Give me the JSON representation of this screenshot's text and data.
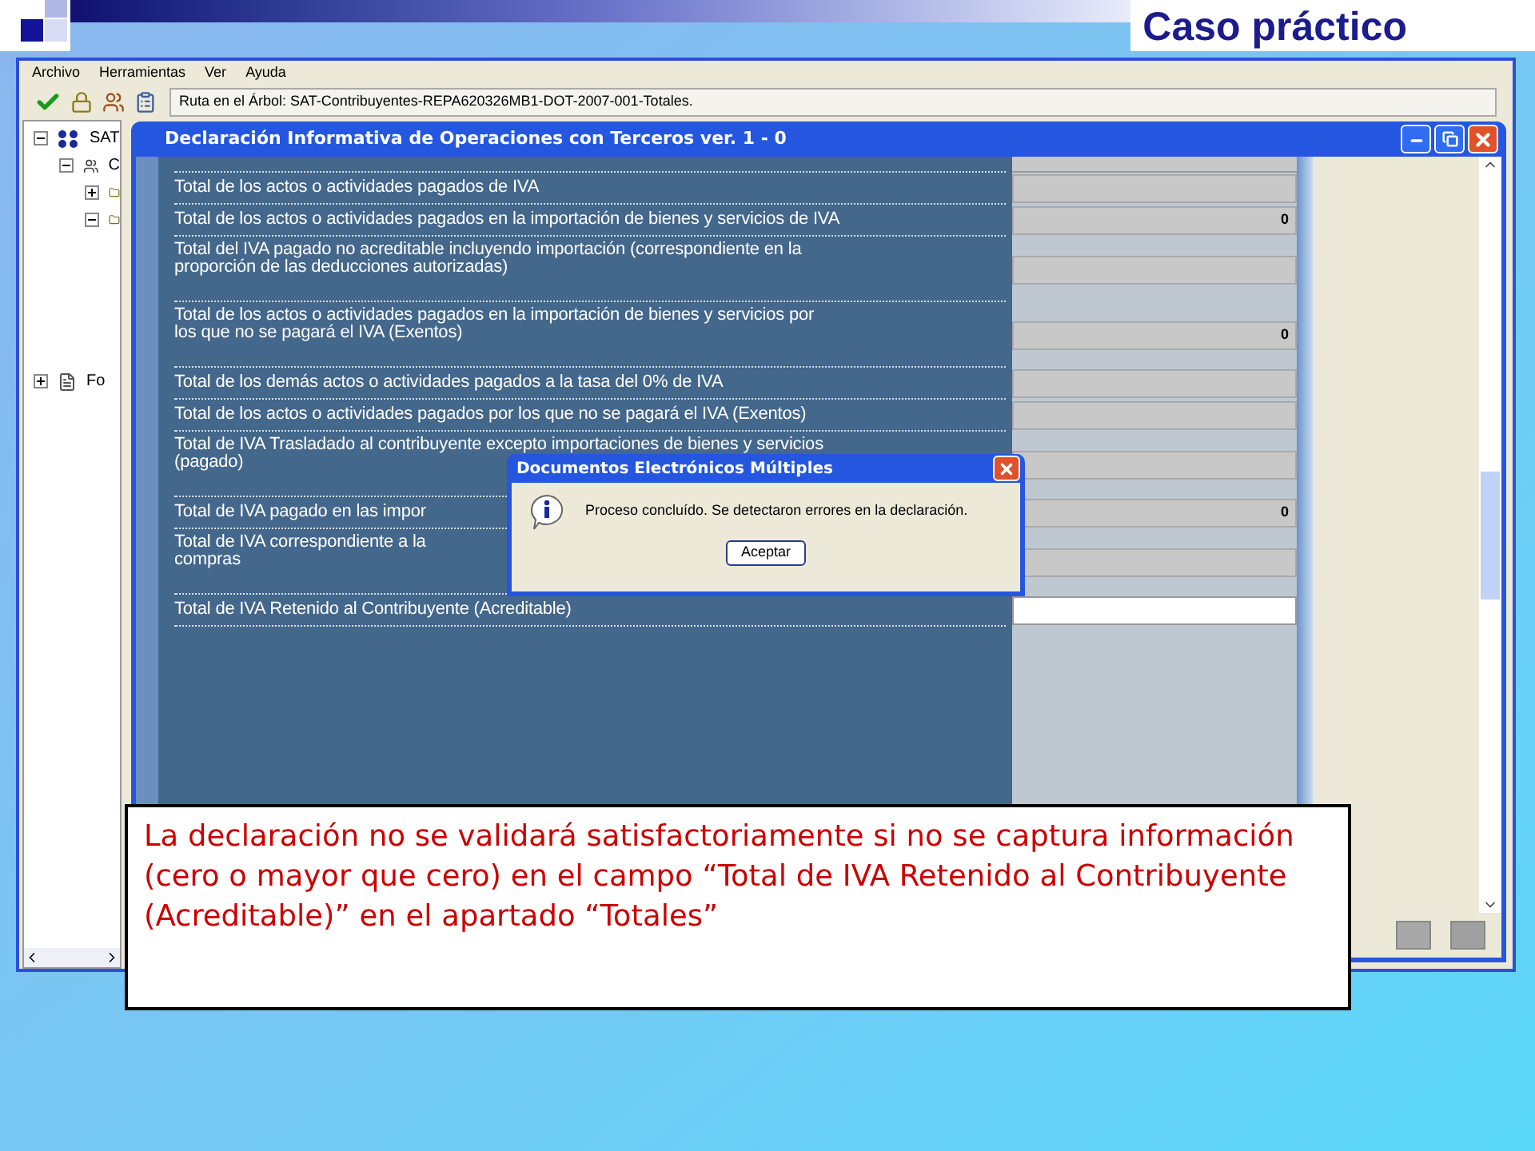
{
  "slide_title": "Caso práctico",
  "app": {
    "menu": [
      "Archivo",
      "Herramientas",
      "Ver",
      "Ayuda"
    ],
    "path": "Ruta en el Árbol: SAT-Contribuyentes-REPA620326MB1-DOT-2007-001-Totales.",
    "tree": [
      {
        "label": "SAT",
        "expanded": true,
        "children": [
          {
            "label": "C",
            "expanded": true,
            "children": [
              {
                "expanded": false
              },
              {
                "expanded": true
              }
            ]
          }
        ]
      },
      {
        "label": "Fo",
        "expanded": false
      }
    ]
  },
  "form_window": {
    "title": "Declaración Informativa de Operaciones con Terceros ver. 1 - 0",
    "rows": [
      {
        "lines": [
          "Total de los actos o actividades pagados de IVA"
        ],
        "highlighted": false
      },
      {
        "lines": [
          "Total de los actos o actividades pagados en la importación de bienes y servicios de IVA"
        ],
        "value": "0",
        "highlighted": false
      },
      {
        "lines": [
          "Total del IVA pagado no acreditable incluyendo importación (correspondiente en la",
          "proporción de las deducciones autorizadas)"
        ],
        "highlighted": false
      },
      {
        "lines": [
          "Total de los actos o actividades pagados en la importación de bienes y servicios por",
          "los que no se pagará el IVA (Exentos)"
        ],
        "value": "0",
        "highlighted": false
      },
      {
        "lines": [
          "Total de los demás actos o actividades pagados a la tasa del 0% de IVA"
        ],
        "highlighted": false
      },
      {
        "lines": [
          "Total de los actos o actividades pagados por los que no se pagará el IVA (Exentos)"
        ],
        "highlighted": false
      },
      {
        "lines": [
          "Total de IVA Trasladado al contribuyente excepto importaciones de bienes y servicios",
          "(pagado)"
        ],
        "highlighted": false
      },
      {
        "lines": [
          "Total de IVA pagado en las impor"
        ],
        "value": "0",
        "highlighted": false
      },
      {
        "lines": [
          "Total de IVA correspondiente a la",
          "compras"
        ],
        "highlighted": false
      },
      {
        "lines": [
          "Total de IVA Retenido al Contribuyente (Acreditable)"
        ],
        "highlighted": true
      }
    ]
  },
  "dialog": {
    "title": "Documentos Electrónicos Múltiples",
    "message": "Proceso concluído. Se detectaron errores en la declaración.",
    "button": "Aceptar"
  },
  "note": "La declaración no se validará satisfactoriamente si no se captura información (cero o mayor que cero) en el campo “Total de IVA Retenido al Contribuyente (Acreditable)” en el apartado “Totales”"
}
